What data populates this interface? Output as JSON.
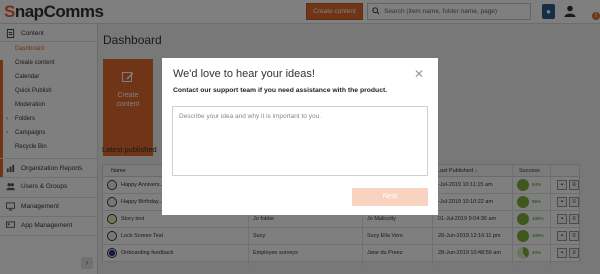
{
  "header": {
    "logo_prefix": "S",
    "logo_rest": "napComms",
    "create_button": "Create content",
    "search_placeholder": "Search (item name, folder name, page)",
    "bulb_icon": "lightbulb-icon",
    "user_icon": "user-icon",
    "badge": "2"
  },
  "sidebar": {
    "content_label": "Content",
    "items": [
      {
        "label": "Dashboard",
        "active": true
      },
      {
        "label": "Create content"
      },
      {
        "label": "Calendar"
      },
      {
        "label": "Quick Publish"
      },
      {
        "label": "Moderation"
      },
      {
        "label": "Folders",
        "expandable": true
      },
      {
        "label": "Campaigns",
        "expandable": true
      },
      {
        "label": "Recycle Bin"
      }
    ],
    "sections": [
      {
        "label": "Organization Reports"
      },
      {
        "label": "Users & Groups"
      },
      {
        "label": "Management"
      },
      {
        "label": "App Management"
      }
    ],
    "collapse_label": "›"
  },
  "main": {
    "title": "Dashboard",
    "tile_label_1": "Create",
    "tile_label_2": "content",
    "latest_label": "Latest published",
    "table": {
      "headers": [
        "Name",
        "",
        "",
        "Last Published ↓",
        "Success"
      ],
      "rows": [
        {
          "name": "Happy Annivers...",
          "folder": "",
          "author": "",
          "date": "-Jul-2019 10:11:15 am",
          "pct": "94%"
        },
        {
          "name": "Happy Birthday...",
          "folder": "",
          "author": "",
          "date": "-Jul-2019 10:10:22 am",
          "pct": "96%"
        },
        {
          "name": "Story test",
          "folder": "Jo folder",
          "author": "Jo Malicotty",
          "date": "01-Jul-2019 9:04:36 am",
          "pct": "100%"
        },
        {
          "name": "Lock Screen Test",
          "folder": "Sucy",
          "author": "Sucy Ella Vero",
          "date": "28-Jun-2019 12:16:11 pm",
          "pct": "100%"
        },
        {
          "name": "Onboarding feedback",
          "folder": "Employee surveys",
          "author": "Jane du Preez",
          "date": "28-Jun-2019 10:48:59 am",
          "pct": "40%"
        }
      ]
    }
  },
  "modal": {
    "title": "We'd love to hear your ideas!",
    "subtitle": "Contact our support team if you need assistance with the product.",
    "placeholder": "Describe your idea and why it is important to you.",
    "next_label": "Next",
    "close_label": "✕"
  },
  "colors": {
    "accent": "#e06a2c",
    "success": "#7fae3a"
  }
}
